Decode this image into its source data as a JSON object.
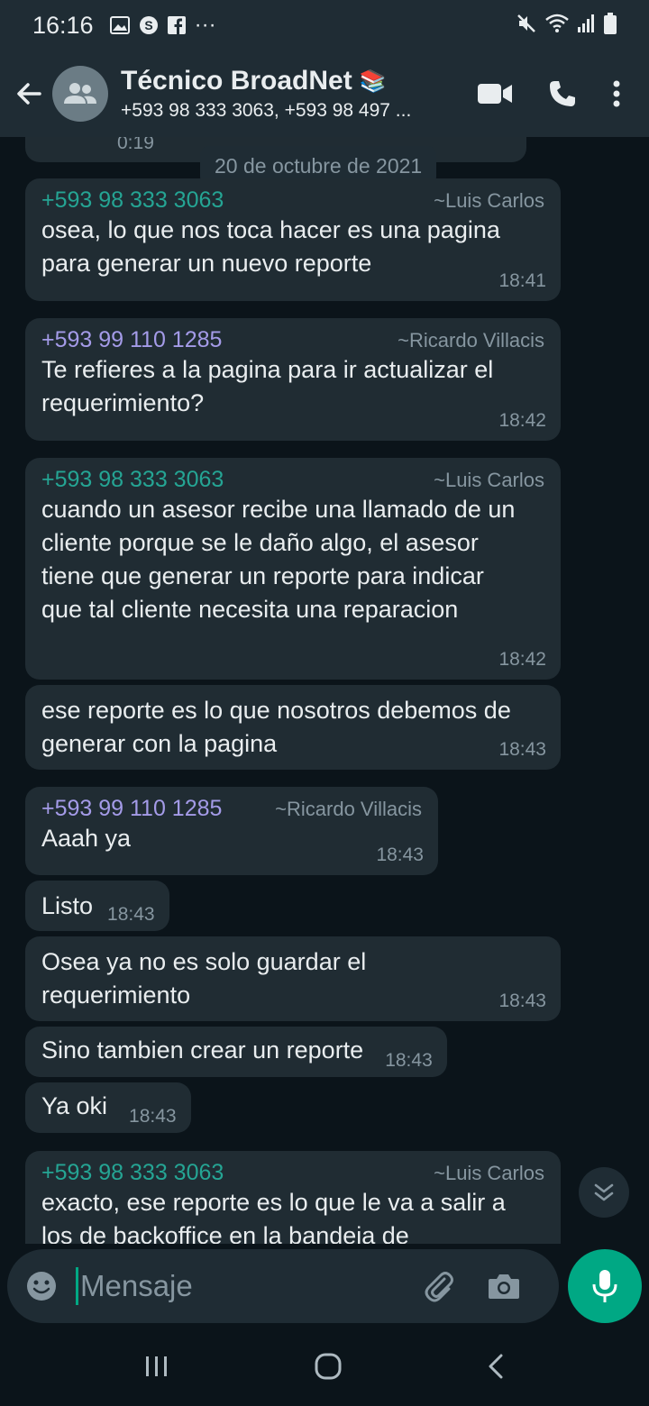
{
  "status_bar": {
    "time": "16:16",
    "more": "···"
  },
  "header": {
    "title": "Técnico BroadNet",
    "title_emoji": "📚",
    "subtitle": "+593 98 333 3063, +593 98 497 ..."
  },
  "chat": {
    "partial_top": {
      "duration": "0:19"
    },
    "date_label": "20 de octubre de 2021",
    "messages": [
      {
        "phone": "+593 98 333 3063",
        "alias": "~Luis Carlos",
        "text": "osea, lo que nos toca hacer es una pagina para generar un nuevo reporte",
        "time": "18:41"
      },
      {
        "phone": "+593 99 110 1285",
        "alias": "~Ricardo Villacis",
        "text": "Te refieres a la pagina para ir actualizar el requerimiento?",
        "time": "18:42"
      },
      {
        "phone": "+593 98 333 3063",
        "alias": "~Luis Carlos",
        "text": "cuando un asesor recibe una llamado de un cliente porque se le daño algo, el asesor tiene que generar un reporte para indicar que tal cliente necesita una reparacion",
        "time": "18:42"
      },
      {
        "text": "ese reporte es lo que nosotros debemos de generar con la pagina",
        "time": "18:43"
      },
      {
        "phone": "+593 99 110 1285",
        "alias": "~Ricardo Villacis",
        "text": "Aaah ya",
        "time": "18:43"
      },
      {
        "text": "Listo",
        "time": "18:43"
      },
      {
        "text": "Osea ya no es solo guardar el requerimiento",
        "time": "18:43"
      },
      {
        "text": "Sino tambien crear un reporte",
        "time": "18:43"
      },
      {
        "text": "Ya oki",
        "time": "18:43"
      },
      {
        "phone": "+593 98 333 3063",
        "alias": "~Luis Carlos",
        "text": "exacto, ese reporte es lo que le va a salir a los de backoffice en la bandeja de"
      }
    ]
  },
  "input": {
    "placeholder": "Mensaje"
  },
  "colors": {
    "background": "#0b141a",
    "bubble": "#202c33",
    "header": "#1f2c34",
    "accent": "#00a884",
    "luis_color": "#25a594",
    "ricardo_color": "#a49be8"
  }
}
